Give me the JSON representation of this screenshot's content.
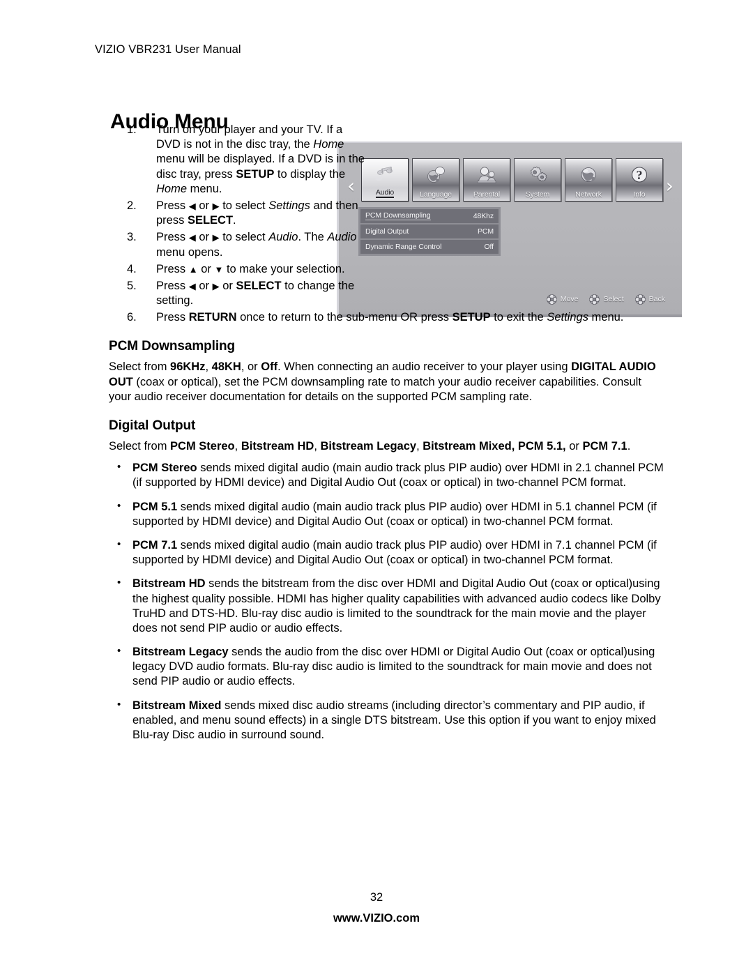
{
  "header": {
    "running_head": "VIZIO VBR231 User Manual"
  },
  "title": "Audio Menu",
  "steps": [
    {
      "num": "1.",
      "segments": [
        {
          "t": "Turn on your player and your TV. If a DVD is not in the disc tray, the ",
          "s": "n"
        },
        {
          "t": "Home",
          "s": "i"
        },
        {
          "t": " menu will be displayed. If a DVD is in the disc tray, press ",
          "s": "n"
        },
        {
          "t": "SETUP",
          "s": "b"
        },
        {
          "t": " to display the ",
          "s": "n"
        },
        {
          "t": "Home",
          "s": "i"
        },
        {
          "t": " menu.",
          "s": "n"
        }
      ]
    },
    {
      "num": "2.",
      "segments": [
        {
          "t": "Press ",
          "s": "n"
        },
        {
          "t": "◀",
          "s": "a"
        },
        {
          "t": " or ",
          "s": "n"
        },
        {
          "t": "▶",
          "s": "a"
        },
        {
          "t": " to select ",
          "s": "n"
        },
        {
          "t": "Settings",
          "s": "i"
        },
        {
          "t": " and then press ",
          "s": "n"
        },
        {
          "t": "SELECT",
          "s": "b"
        },
        {
          "t": ".",
          "s": "n"
        }
      ]
    },
    {
      "num": "3.",
      "segments": [
        {
          "t": "Press ",
          "s": "n"
        },
        {
          "t": "◀",
          "s": "a"
        },
        {
          "t": " or ",
          "s": "n"
        },
        {
          "t": "▶",
          "s": "a"
        },
        {
          "t": " to select ",
          "s": "n"
        },
        {
          "t": "Audio",
          "s": "i"
        },
        {
          "t": ". The ",
          "s": "n"
        },
        {
          "t": "Audio",
          "s": "i"
        },
        {
          "t": " menu opens.",
          "s": "n"
        }
      ]
    },
    {
      "num": "4.",
      "segments": [
        {
          "t": "Press ",
          "s": "n"
        },
        {
          "t": "▲",
          "s": "a"
        },
        {
          "t": " or ",
          "s": "n"
        },
        {
          "t": "▼",
          "s": "a"
        },
        {
          "t": " to make your selection.",
          "s": "n"
        }
      ]
    },
    {
      "num": "5.",
      "segments": [
        {
          "t": "Press ",
          "s": "n"
        },
        {
          "t": "◀",
          "s": "a"
        },
        {
          "t": " or ",
          "s": "n"
        },
        {
          "t": "▶",
          "s": "a"
        },
        {
          "t": " or ",
          "s": "n"
        },
        {
          "t": "SELECT",
          "s": "b"
        },
        {
          "t": " to change the setting.",
          "s": "n"
        }
      ]
    },
    {
      "num": "6.",
      "segments": [
        {
          "t": "Press ",
          "s": "n"
        },
        {
          "t": "RETURN",
          "s": "b"
        },
        {
          "t": " once to return to the sub-menu OR press ",
          "s": "n"
        },
        {
          "t": "SETUP",
          "s": "b"
        },
        {
          "t": " to exit the ",
          "s": "n"
        },
        {
          "t": "Settings",
          "s": "i"
        },
        {
          "t": " menu.",
          "s": "n"
        }
      ]
    }
  ],
  "sections": [
    {
      "heading": "PCM Downsampling",
      "paragraph": [
        {
          "t": "Select from ",
          "s": "n"
        },
        {
          "t": "96KHz",
          "s": "b"
        },
        {
          "t": ", ",
          "s": "n"
        },
        {
          "t": "48KH",
          "s": "b"
        },
        {
          "t": ", or ",
          "s": "n"
        },
        {
          "t": "Off",
          "s": "b"
        },
        {
          "t": ". When connecting an audio receiver to your player using ",
          "s": "n"
        },
        {
          "t": "DIGITAL AUDIO OUT",
          "s": "b"
        },
        {
          "t": " (coax or optical), set the PCM downsampling rate to match your audio receiver capabilities. Consult your audio receiver documentation for details on the supported PCM sampling rate.",
          "s": "n"
        }
      ]
    },
    {
      "heading": "Digital Output",
      "paragraph": [
        {
          "t": "Select from ",
          "s": "n"
        },
        {
          "t": "PCM Stereo",
          "s": "b"
        },
        {
          "t": ", ",
          "s": "n"
        },
        {
          "t": "Bitstream HD",
          "s": "b"
        },
        {
          "t": ", ",
          "s": "n"
        },
        {
          "t": "Bitstream Legacy",
          "s": "b"
        },
        {
          "t": ", ",
          "s": "n"
        },
        {
          "t": "Bitstream Mixed, PCM 5.1,",
          "s": "b"
        },
        {
          "t": " or ",
          "s": "n"
        },
        {
          "t": "PCM 7.1",
          "s": "b"
        },
        {
          "t": ".",
          "s": "n"
        }
      ]
    }
  ],
  "bullets": [
    {
      "bullet": "•",
      "segments": [
        {
          "t": "PCM Stereo",
          "s": "b"
        },
        {
          "t": " sends mixed digital audio (main audio track plus PIP audio) over HDMI in 2.1 channel PCM (if supported by HDMI device) and Digital Audio Out (coax or optical) in two-channel PCM format.",
          "s": "n"
        }
      ]
    },
    {
      "bullet": "•",
      "segments": [
        {
          "t": "PCM 5.1",
          "s": "b"
        },
        {
          "t": " sends mixed digital audio (main audio track plus PIP audio) over HDMI in 5.1 channel PCM (if supported by HDMI device) and Digital Audio Out (coax or optical) in two-channel PCM format.",
          "s": "n"
        }
      ]
    },
    {
      "bullet": "•",
      "segments": [
        {
          "t": "PCM 7.1",
          "s": "b"
        },
        {
          "t": " sends mixed digital audio (main audio track plus PIP audio) over HDMI in 7.1 channel PCM (if supported by HDMI device) and Digital Audio Out (coax or optical) in two-channel PCM format.",
          "s": "n"
        }
      ]
    },
    {
      "bullet": "•",
      "segments": [
        {
          "t": "Bitstream HD",
          "s": "b"
        },
        {
          "t": " sends the bitstream from the disc over HDMI and Digital Audio Out (coax or optical)using the highest quality possible. HDMI has higher quality capabilities with advanced audio codecs like Dolby TruHD and DTS-HD. Blu-ray disc audio is limited to the soundtrack for the main movie and the player does not send PIP audio or audio effects.",
          "s": "n"
        }
      ]
    },
    {
      "bullet": "•",
      "segments": [
        {
          "t": "Bitstream Legacy",
          "s": "b"
        },
        {
          "t": " sends the audio from the disc over HDMI or Digital Audio Out (coax or optical)using legacy DVD audio formats. Blu-ray disc audio is limited to the soundtrack for main movie and does not send PIP audio or audio effects.",
          "s": "n"
        }
      ]
    },
    {
      "bullet": "•",
      "segments": [
        {
          "t": "Bitstream Mixed",
          "s": "b"
        },
        {
          "t": " sends mixed disc audio streams (including director’s commentary and PIP audio, if enabled, and menu sound effects) in a single DTS bitstream. Use this option if you want to enjoy mixed Blu-ray Disc audio in surround sound.",
          "s": "n"
        }
      ]
    }
  ],
  "device_ui": {
    "left_arrow": "‹",
    "right_arrow": "›",
    "tiles": [
      {
        "label": "Audio",
        "icon": "music-note-icon",
        "selected": true
      },
      {
        "label": "Language",
        "icon": "globe-speech-icon",
        "selected": false
      },
      {
        "label": "Parental",
        "icon": "people-icon",
        "selected": false
      },
      {
        "label": "System",
        "icon": "gears-icon",
        "selected": false
      },
      {
        "label": "Network",
        "icon": "globe-icon",
        "selected": false
      },
      {
        "label": "Info",
        "icon": "question-mark-icon",
        "selected": false
      }
    ],
    "settings": [
      {
        "label": "PCM Downsampling",
        "value": "48Khz",
        "highlighted": true
      },
      {
        "label": "Digital Output",
        "value": "PCM",
        "highlighted": false
      },
      {
        "label": "Dynamic Range Control",
        "value": "Off",
        "highlighted": false
      }
    ],
    "legend": [
      {
        "label": "Move",
        "icon": "dpad-icon"
      },
      {
        "label": "Select",
        "icon": "dpad-icon"
      },
      {
        "label": "Back",
        "icon": "dpad-icon"
      }
    ]
  },
  "footer": {
    "page_number": "32",
    "website": "www.VIZIO.com"
  },
  "colors": {
    "page_background": "#ffffff",
    "text": "#000000",
    "ui_panel": "#b5b5b9",
    "ui_row": "#6f6f77",
    "ui_row_frame": "#8e8e95"
  }
}
